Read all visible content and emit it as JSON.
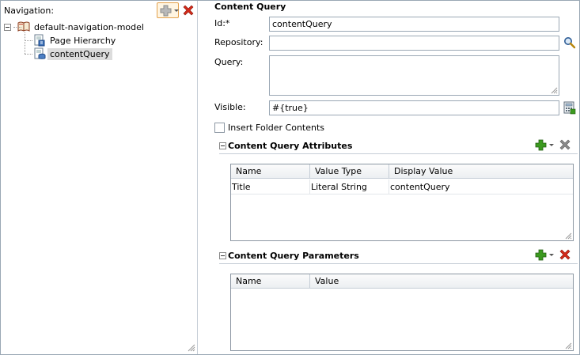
{
  "navigation": {
    "header_label": "Navigation:",
    "tree": {
      "root": {
        "label": "default-navigation-model",
        "icon": "book-icon"
      },
      "children": [
        {
          "label": "Page Hierarchy",
          "icon": "page-hierarchy-icon",
          "selected": false
        },
        {
          "label": "contentQuery",
          "icon": "content-query-icon",
          "selected": true
        }
      ]
    },
    "toolbar": {
      "add": "add-icon",
      "delete": "delete-icon"
    }
  },
  "form": {
    "section_title": "Content Query",
    "id_label": "Id:*",
    "id_value": "contentQuery",
    "repository_label": "Repository:",
    "repository_value": "",
    "query_label": "Query:",
    "query_value": "",
    "visible_label": "Visible:",
    "visible_value": "#{true}",
    "insert_folder_label": "Insert Folder Contents",
    "insert_folder_checked": false
  },
  "attributes": {
    "title": "Content Query Attributes",
    "columns": [
      "Name",
      "Value Type",
      "Display Value"
    ],
    "rows": [
      {
        "name": "Title",
        "value_type": "Literal String",
        "display_value": "contentQuery"
      }
    ]
  },
  "parameters": {
    "title": "Content Query Parameters",
    "columns": [
      "Name",
      "Value"
    ],
    "rows": []
  },
  "colors": {
    "add_green": "#3c9a1f",
    "delete_red": "#d42a1a",
    "delete_disabled": "#8a8a8a",
    "border": "#9aa7b4"
  }
}
